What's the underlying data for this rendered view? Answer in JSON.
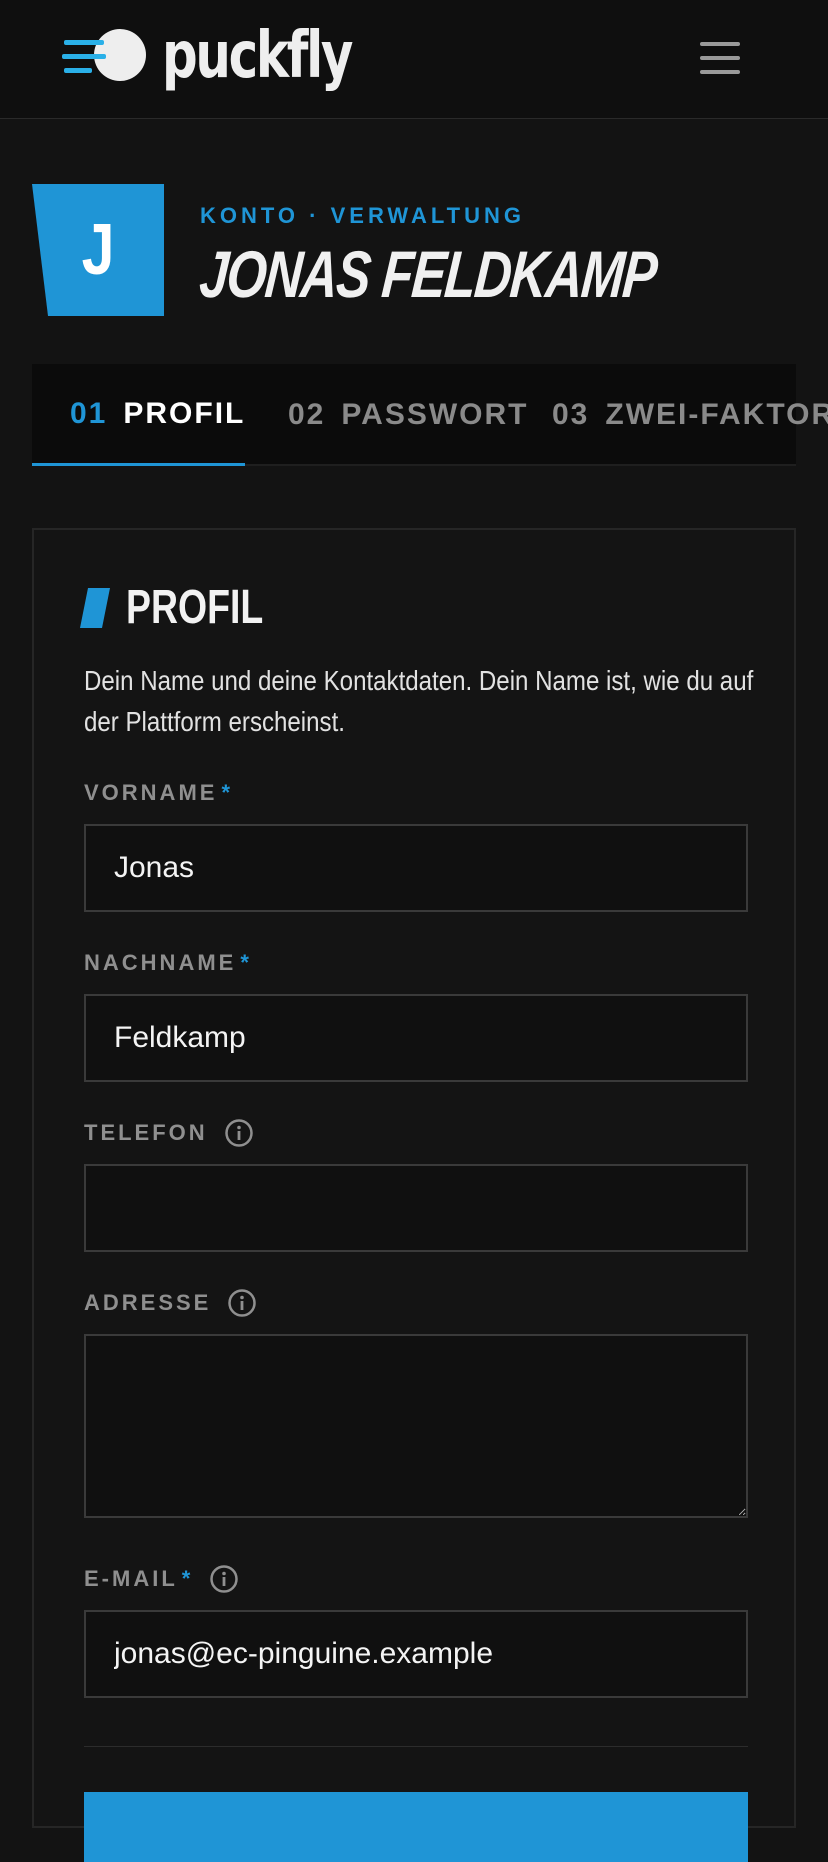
{
  "brand": {
    "name": "puckfly",
    "accent": "#1f95d6",
    "logo_line_color": "#2ab0e8"
  },
  "header": {
    "menu_icon": "hamburger-icon"
  },
  "account": {
    "initial": "J",
    "eyebrow": "KONTO · VERWALTUNG",
    "name": "JONAS FELDKAMP"
  },
  "tabs": [
    {
      "num": "01",
      "label": "PROFIL",
      "active": true
    },
    {
      "num": "02",
      "label": "PASSWORT",
      "active": false
    },
    {
      "num": "03",
      "label": "ZWEI-FAKTOR",
      "active": false
    }
  ],
  "profile": {
    "title": "PROFIL",
    "description": "Dein Name und deine Kontaktdaten. Dein Name ist, wie du auf der Plattform erscheinst.",
    "fields": {
      "first_name": {
        "label": "VORNAME",
        "required": "*",
        "value": "Jonas"
      },
      "last_name": {
        "label": "NACHNAME",
        "required": "*",
        "value": "Feldkamp"
      },
      "phone": {
        "label": "TELEFON",
        "value": "",
        "icon": "info-icon"
      },
      "address": {
        "label": "ADRESSE",
        "value": "",
        "icon": "info-icon"
      },
      "email": {
        "label": "E-MAIL",
        "required": "*",
        "value": "jonas@ec-pinguine.example",
        "icon": "info-icon"
      }
    }
  }
}
